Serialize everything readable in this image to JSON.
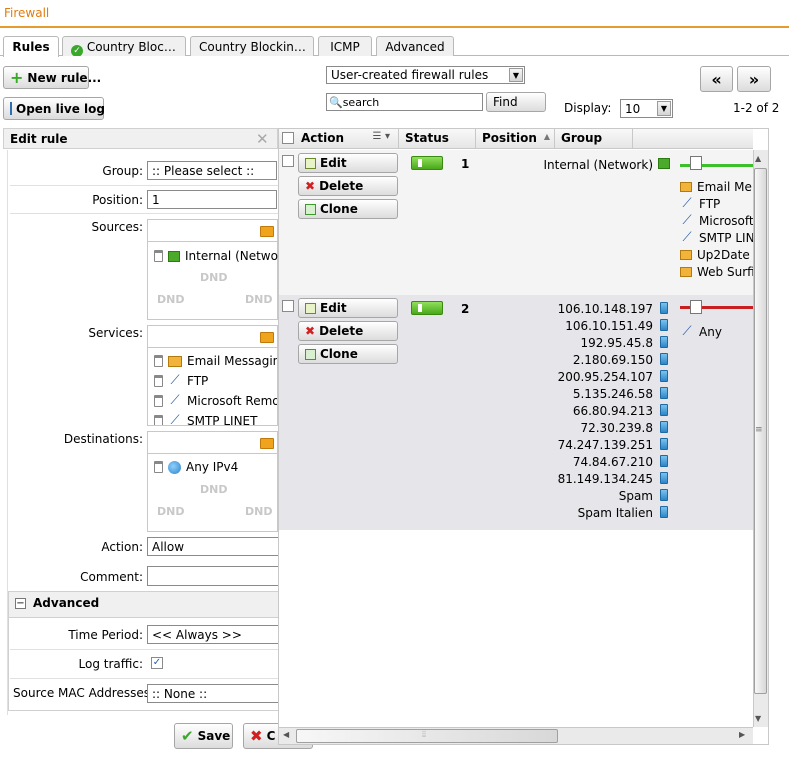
{
  "app_title": "Firewall",
  "tabs": [
    {
      "label": "Rules",
      "active": true
    },
    {
      "label": "Country Bloc…",
      "icon": "check-circle-icon"
    },
    {
      "label": "Country Blockin…"
    },
    {
      "label": "ICMP"
    },
    {
      "label": "Advanced"
    }
  ],
  "toolbar": {
    "new_rule": "New rule...",
    "open_live_log": "Open live log",
    "filter_value": "User-created firewall rules",
    "search_placeholder": "search",
    "find": "Find",
    "display_label": "Display:",
    "display_value": "10",
    "pagination": "1-2 of 2",
    "prev": "«",
    "next": "»"
  },
  "edit_rule": {
    "title": "Edit rule",
    "group_label": "Group:",
    "group_value": ":: Please select ::",
    "position_label": "Position:",
    "position_value": "1",
    "sources_label": "Sources:",
    "sources": [
      "Internal (Netwo"
    ],
    "services_label": "Services:",
    "services": [
      "Email Messagin",
      "FTP",
      "Microsoft Remo",
      "SMTP LINET"
    ],
    "destinations_label": "Destinations:",
    "destinations": [
      "Any IPv4"
    ],
    "dnd": "DND",
    "action_label": "Action:",
    "action_value": "Allow",
    "comment_label": "Comment:",
    "advanced_title": "Advanced",
    "time_period_label": "Time Period:",
    "time_period_value": "<< Always >>",
    "log_traffic_label": "Log traffic:",
    "mac_label": "Source MAC Addresses",
    "mac_value": ":: None ::",
    "save": "Save",
    "cancel": "C"
  },
  "grid": {
    "columns": [
      "Action",
      "Status",
      "Position",
      "Group"
    ],
    "row_actions": {
      "edit": "Edit",
      "delete": "Delete",
      "clone": "Clone"
    },
    "rows": [
      {
        "position": "1",
        "sources": [
          "Internal (Network)"
        ],
        "services": [
          "Email Me",
          "FTP",
          "Microsoft",
          "SMTP LIN",
          "Up2Date",
          "Web Surfi"
        ]
      },
      {
        "position": "2",
        "sources": [
          "106.10.148.197",
          "106.10.151.49",
          "192.95.45.8",
          "2.180.69.150",
          "200.95.254.107",
          "5.135.246.58",
          "66.80.94.213",
          "72.30.239.8",
          "74.247.139.251",
          "74.84.67.210",
          "81.149.134.245",
          "Spam",
          "Spam Italien"
        ],
        "services": [
          "Any"
        ]
      }
    ]
  }
}
